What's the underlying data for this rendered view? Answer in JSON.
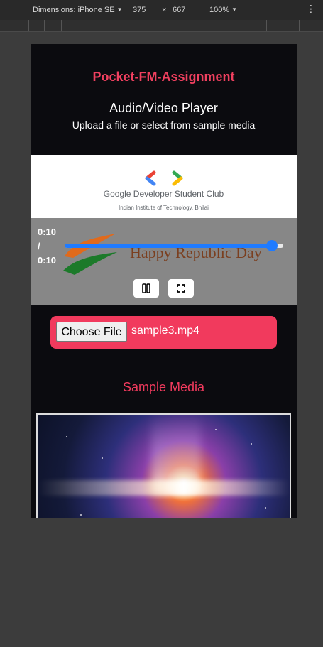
{
  "devtools": {
    "dimensions_label": "Dimensions: iPhone SE",
    "width": "375",
    "times": "×",
    "height": "667",
    "zoom": "100%"
  },
  "app": {
    "title": "Pocket-FM-Assignment",
    "player_heading": "Audio/Video Player",
    "player_subheading": "Upload a file or select from sample media"
  },
  "video": {
    "logo_name": "Google Developer Student Club",
    "logo_sub": "Indian Institute of Technology, Bhilai",
    "caption": "Happy Republic Day",
    "current_time": "0:10",
    "separator": "/",
    "duration": "0:10",
    "progress": 1.0,
    "seek_color": "#1f7bff"
  },
  "file_input": {
    "button_label": "Choose File",
    "file_name": "sample3.mp4",
    "accent": "#f13a5d"
  },
  "sample_media": {
    "title": "Sample Media"
  },
  "icons": {
    "pause": "pause-icon",
    "fullscreen": "fullscreen-icon",
    "kebab": "kebab-menu-icon"
  }
}
